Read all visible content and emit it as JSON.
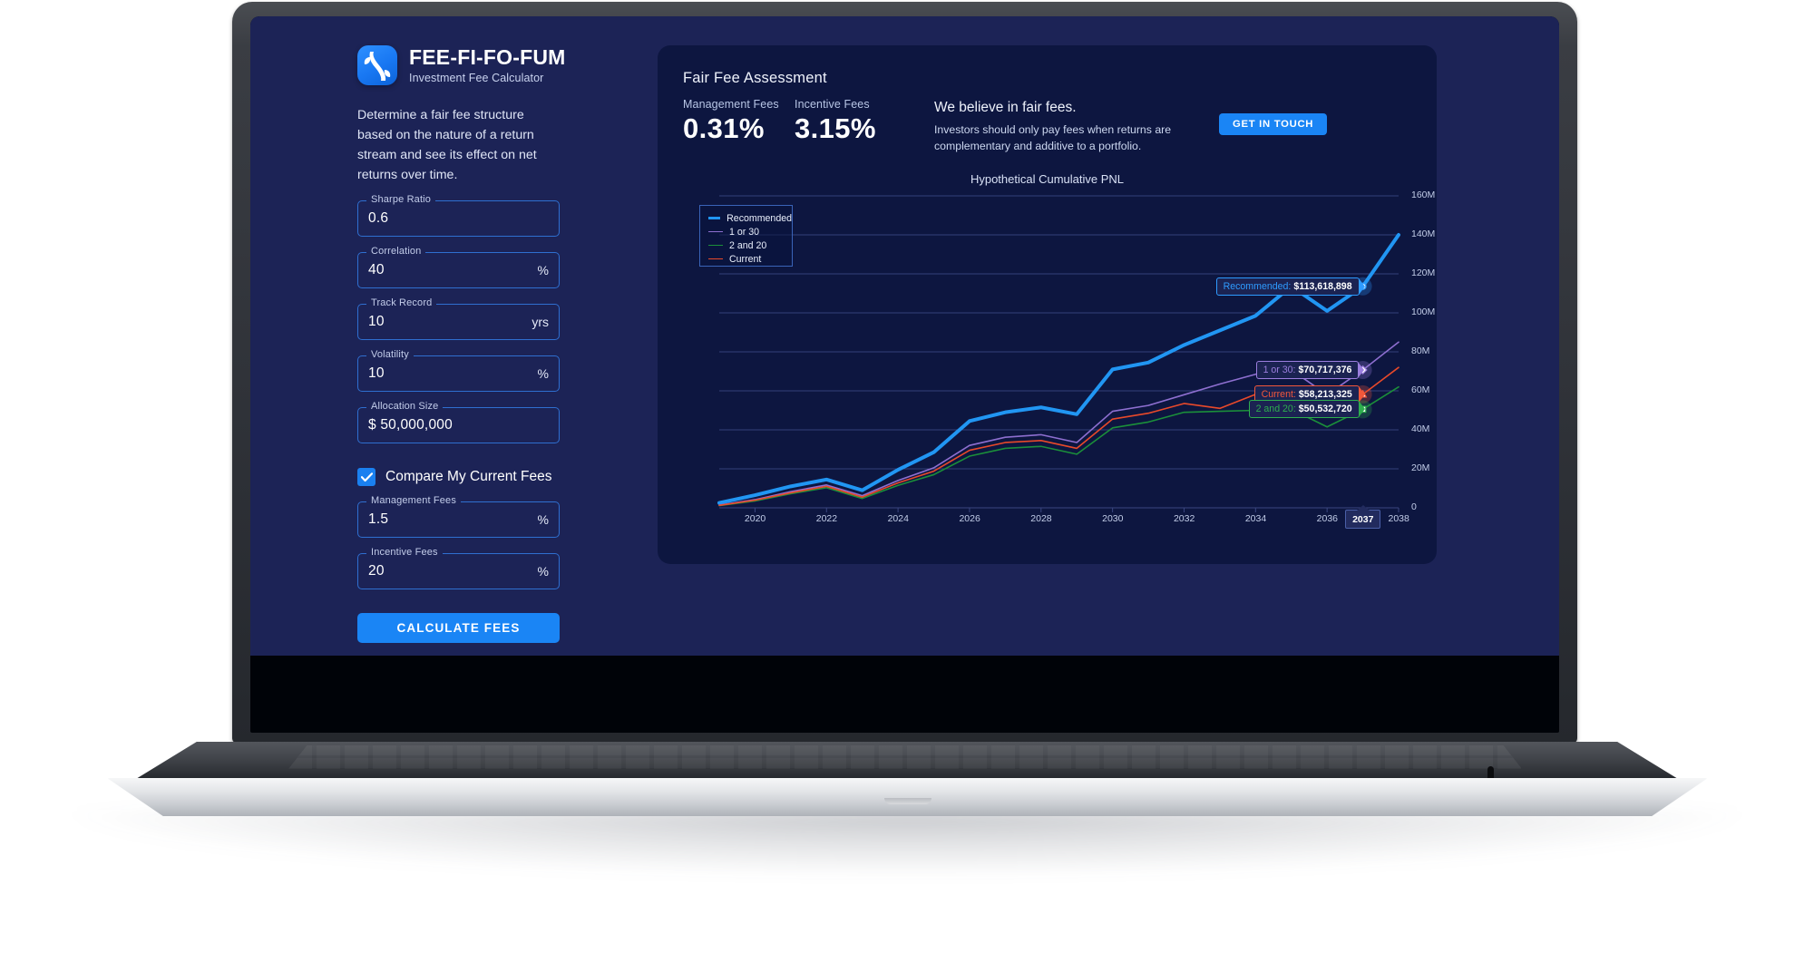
{
  "brand": {
    "title": "FEE-FI-FO-FUM",
    "subtitle": "Investment Fee Calculator",
    "blurb": "Determine a fair fee structure based on the nature of a return stream and see its effect on net returns over time."
  },
  "form": {
    "fields": [
      {
        "label": "Sharpe Ratio",
        "value": "0.6",
        "suffix": ""
      },
      {
        "label": "Correlation",
        "value": "40",
        "suffix": "%"
      },
      {
        "label": "Track Record",
        "value": "10",
        "suffix": "yrs"
      },
      {
        "label": "Volatility",
        "value": "10",
        "suffix": "%"
      },
      {
        "label": "Allocation Size",
        "value": "$ 50,000,000",
        "suffix": ""
      }
    ],
    "compare_checkbox": {
      "label": "Compare My Current Fees",
      "checked": true
    },
    "compare_fields": [
      {
        "label": "Management Fees",
        "value": "1.5",
        "suffix": "%"
      },
      {
        "label": "Incentive Fees",
        "value": "20",
        "suffix": "%"
      }
    ],
    "calculate_label": "CALCULATE FEES"
  },
  "panel": {
    "title": "Fair Fee Assessment",
    "stats": [
      {
        "label": "Management Fees",
        "value": "0.31%"
      },
      {
        "label": "Incentive Fees",
        "value": "3.15%"
      }
    ],
    "pitch_head": "We believe in fair fees.",
    "pitch_body": "Investors should only pay fees when returns are complementary and additive to a portfolio.",
    "touch_label": "GET IN TOUCH"
  },
  "chart_data": {
    "type": "line",
    "title": "Hypothetical Cumulative PNL",
    "xlabel": "",
    "ylabel": "",
    "grid": true,
    "legend_position": "top-left",
    "x": [
      2019,
      2020,
      2021,
      2022,
      2023,
      2024,
      2025,
      2026,
      2027,
      2028,
      2029,
      2030,
      2031,
      2032,
      2033,
      2034,
      2035,
      2036,
      2037,
      2038
    ],
    "xticks": [
      2020,
      2022,
      2024,
      2026,
      2028,
      2030,
      2032,
      2034,
      2036,
      2038
    ],
    "yticks": [
      "0",
      "20M",
      "40M",
      "60M",
      "80M",
      "100M",
      "120M",
      "140M",
      "160M"
    ],
    "ylim": [
      0,
      160000000
    ],
    "xlim": [
      2019,
      2038
    ],
    "hover_year": "2037",
    "series": [
      {
        "name": "Recommended",
        "color": "#2196f3",
        "width": 4,
        "values": [
          2500000,
          6500000,
          11000000,
          14500000,
          9000000,
          19500000,
          28500000,
          44500000,
          49000000,
          51500000,
          48000000,
          71000000,
          74500000,
          83500000,
          91000000,
          98500000,
          113618898,
          101000000,
          113618898,
          140000000
        ]
      },
      {
        "name": "1 or 30",
        "color": "#8e6fd0",
        "width": 1.6,
        "values": [
          1400000,
          4200000,
          8300000,
          11700000,
          6200000,
          14000000,
          20500000,
          32000000,
          36200000,
          37500000,
          33500000,
          49500000,
          52500000,
          58000000,
          63500000,
          68500000,
          70717376,
          58000000,
          70717376,
          85000000
        ]
      },
      {
        "name": "2 and 20",
        "color": "#1b8f3a",
        "width": 1.6,
        "values": [
          1100000,
          3500000,
          7200000,
          10300000,
          4800000,
          11500000,
          17000000,
          26500000,
          30500000,
          31500000,
          27500000,
          41000000,
          44000000,
          49000000,
          49500000,
          50000000,
          50532720,
          41500000,
          50532720,
          62000000
        ]
      },
      {
        "name": "Current",
        "color": "#e8492a",
        "width": 1.6,
        "values": [
          1250000,
          3900000,
          7700000,
          11000000,
          5500000,
          12800000,
          18800000,
          29500000,
          33500000,
          34500000,
          30500000,
          45500000,
          48500000,
          53500000,
          51000000,
          58213325,
          58213325,
          47500000,
          58213325,
          72000000
        ]
      }
    ],
    "annotations": [
      {
        "series": "Recommended",
        "label": "Recommended",
        "value": "$113,618,898",
        "color": "#2e9bff",
        "marker": "circle"
      },
      {
        "series": "1 or 30",
        "label": "1 or 30",
        "value": "$70,717,376",
        "color": "#9b7ede",
        "marker": "diamond"
      },
      {
        "series": "Current",
        "label": "Current",
        "value": "$58,213,325",
        "color": "#f2573a",
        "marker": "triangle"
      },
      {
        "series": "2 and 20",
        "label": "2 and 20",
        "value": "$50,532,720",
        "color": "#2eae4e",
        "marker": "square"
      }
    ]
  }
}
